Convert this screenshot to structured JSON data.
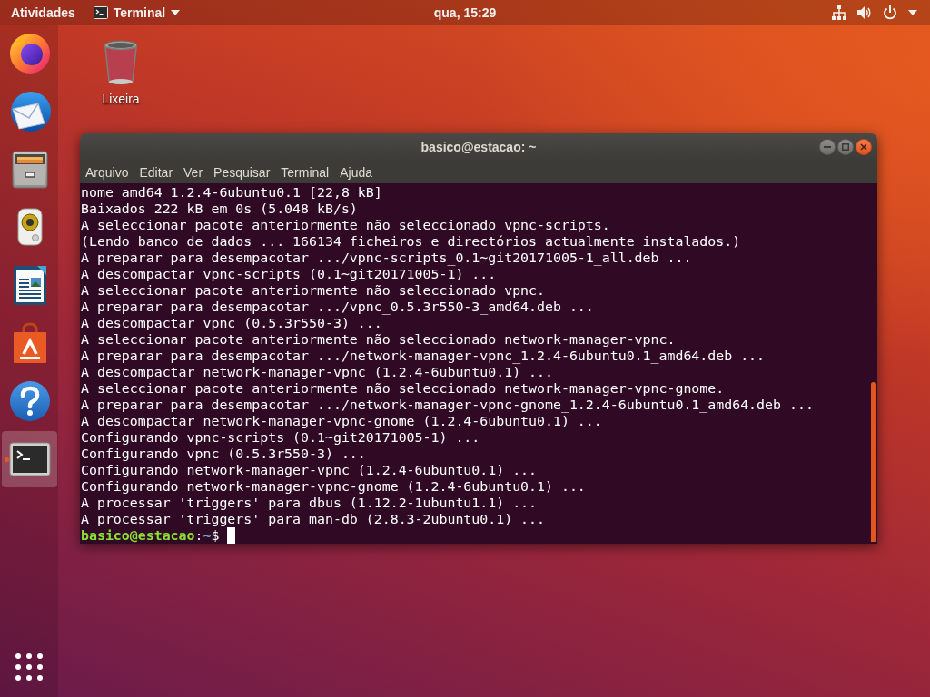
{
  "top_bar": {
    "activities": "Atividades",
    "app_menu": "Terminal",
    "clock": "qua, 15:29"
  },
  "dock": {
    "items": [
      {
        "kind": "browser",
        "running": false,
        "selected": false
      },
      {
        "kind": "mail",
        "running": false,
        "selected": false
      },
      {
        "kind": "files",
        "running": false,
        "selected": false
      },
      {
        "kind": "music",
        "running": false,
        "selected": false
      },
      {
        "kind": "writer",
        "running": false,
        "selected": false
      },
      {
        "kind": "store",
        "running": false,
        "selected": false
      },
      {
        "kind": "help",
        "running": false,
        "selected": false
      },
      {
        "kind": "terminal",
        "running": true,
        "selected": true
      }
    ]
  },
  "desktop": {
    "icons": [
      {
        "kind": "trash",
        "label": "Lixeira"
      }
    ]
  },
  "terminal_window": {
    "title": "basico@estacao: ~",
    "menu": [
      "Arquivo",
      "Editar",
      "Ver",
      "Pesquisar",
      "Terminal",
      "Ajuda"
    ],
    "output": [
      "nome amd64 1.2.4-6ubuntu0.1 [22,8 kB]",
      "Baixados 222 kB em 0s (5.048 kB/s)",
      "A seleccionar pacote anteriormente não seleccionado vpnc-scripts.",
      "(Lendo banco de dados ... 166134 ficheiros e directórios actualmente instalados.)",
      "A preparar para desempacotar .../vpnc-scripts_0.1~git20171005-1_all.deb ...",
      "A descompactar vpnc-scripts (0.1~git20171005-1) ...",
      "A seleccionar pacote anteriormente não seleccionado vpnc.",
      "A preparar para desempacotar .../vpnc_0.5.3r550-3_amd64.deb ...",
      "A descompactar vpnc (0.5.3r550-3) ...",
      "A seleccionar pacote anteriormente não seleccionado network-manager-vpnc.",
      "A preparar para desempacotar .../network-manager-vpnc_1.2.4-6ubuntu0.1_amd64.deb ...",
      "A descompactar network-manager-vpnc (1.2.4-6ubuntu0.1) ...",
      "A seleccionar pacote anteriormente não seleccionado network-manager-vpnc-gnome.",
      "A preparar para desempacotar .../network-manager-vpnc-gnome_1.2.4-6ubuntu0.1_amd64.deb ...",
      "A descompactar network-manager-vpnc-gnome (1.2.4-6ubuntu0.1) ...",
      "Configurando vpnc-scripts (0.1~git20171005-1) ...",
      "Configurando vpnc (0.5.3r550-3) ...",
      "Configurando network-manager-vpnc (1.2.4-6ubuntu0.1) ...",
      "Configurando network-manager-vpnc-gnome (1.2.4-6ubuntu0.1) ...",
      "A processar 'triggers' para dbus (1.12.2-1ubuntu1.1) ...",
      "A processar 'triggers' para man-db (2.8.3-2ubuntu0.1) ..."
    ],
    "prompt": {
      "user_host": "basico@estacao",
      "separator": ":",
      "path": "~",
      "symbol": "$"
    }
  }
}
